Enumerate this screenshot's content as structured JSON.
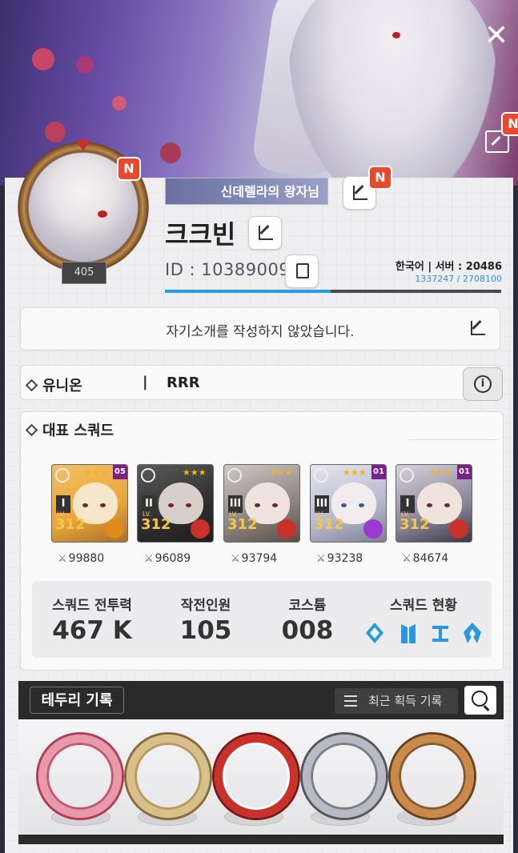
{
  "header": {
    "close_icon": "close-icon",
    "edit_banner_icon": "edit-icon",
    "new_badge": "N"
  },
  "profile": {
    "level": "405",
    "title_plate": "신데렐라의 왕자님",
    "nickname": "크크빈",
    "id_text": "ID : 10389009",
    "server_text": "한국어 | 서버 : 20486",
    "exp_text": "1337247 / 2708100",
    "exp_fraction": 0.494
  },
  "intro": {
    "text": "자기소개를 작성하지 않았습니다."
  },
  "union": {
    "label": "유니온",
    "separator": "|",
    "name": "RRR"
  },
  "squad": {
    "label": "대표 스쿼드",
    "cards": [
      {
        "class": "I",
        "dupe": "05",
        "level": "312",
        "level_prefix": "LV.",
        "power": "99880",
        "element": "iron",
        "stars": "★★★"
      },
      {
        "class": "II",
        "dupe": "",
        "level": "312",
        "level_prefix": "LV.",
        "power": "96089",
        "element": "fire",
        "stars": "★★★"
      },
      {
        "class": "III",
        "dupe": "",
        "level": "312",
        "level_prefix": "LV.",
        "power": "93794",
        "element": "fire",
        "stars": "★★★"
      },
      {
        "class": "III",
        "dupe": "01",
        "level": "312",
        "level_prefix": "LV.",
        "power": "93238",
        "element": "electric",
        "stars": "★★★"
      },
      {
        "class": "I",
        "dupe": "01",
        "level": "312",
        "level_prefix": "LV.",
        "power": "84674",
        "element": "fire",
        "stars": "★★★"
      }
    ],
    "stats": {
      "power_label": "스쿼드 전투력",
      "power_value": "467 K",
      "ops_label": "작전인원",
      "ops_value": "105",
      "costume_label": "코스튬",
      "costume_value": "008",
      "status_label": "스쿼드 현황"
    }
  },
  "tedori": {
    "title": "테두리 기록",
    "recent_label": "최근 획득 기록",
    "frames": [
      "pink-ribbon-frame",
      "straw-hat-frame",
      "red-cat-frame",
      "silver-frame",
      "gold-laurel-frame"
    ]
  },
  "colors": {
    "accent_blue": "#2d9be0",
    "badge_red": "#e8492d",
    "fire": "#c8322a",
    "iron": "#e08a1e",
    "electric": "#9c3ad0"
  }
}
